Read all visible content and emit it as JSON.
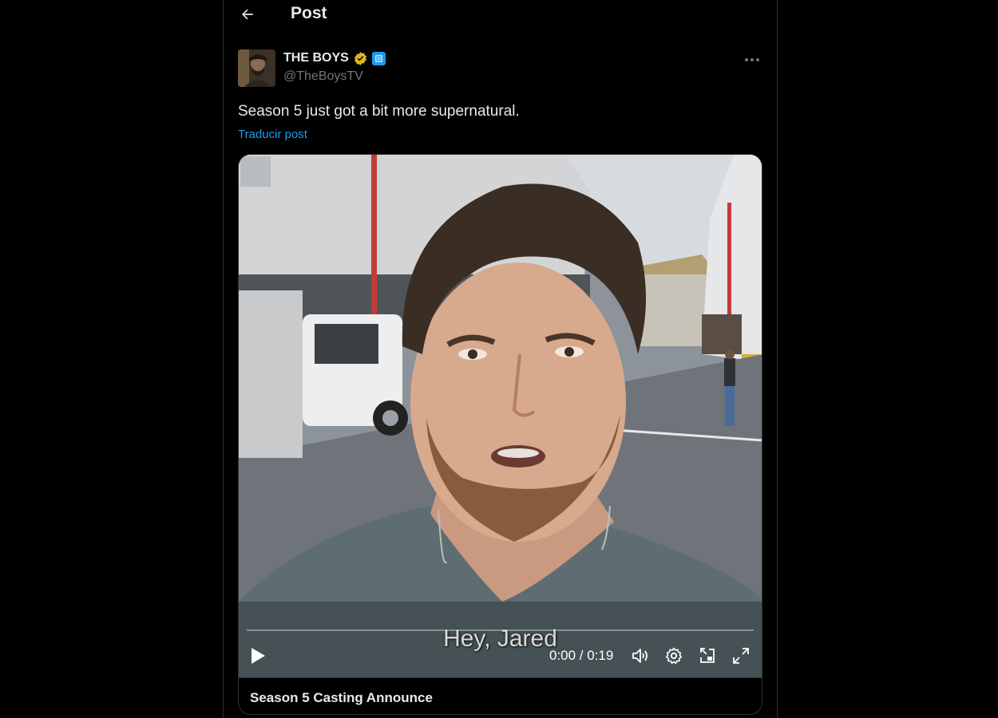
{
  "header": {
    "title": "Post"
  },
  "post": {
    "author": {
      "display_name": "THE BOYS",
      "handle": "@TheBoysTV"
    },
    "text": "Season 5 just got a bit more supernatural.",
    "translate_label": "Traducir post",
    "video": {
      "subtitle": "Hey, Jared",
      "time": "0:00 / 0:19",
      "progress": 0,
      "caption": "Season 5 Casting Announce"
    }
  },
  "colors": {
    "accent": "#1d9bf0",
    "verified_gold": "#e2b719",
    "background": "#000000"
  },
  "icons": [
    "back-arrow-icon",
    "verified-badge-icon",
    "affiliate-badge-icon",
    "more-icon",
    "play-icon",
    "volume-icon",
    "settings-icon",
    "pip-icon",
    "fullscreen-icon"
  ]
}
